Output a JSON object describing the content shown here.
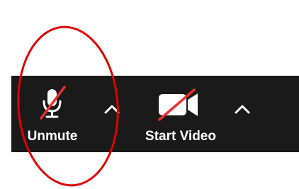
{
  "toolbar": {
    "background": "#1a1a1a",
    "audio": {
      "label": "Unmute",
      "icon": "microphone-muted-icon",
      "slash_color": "#e8302f",
      "menu_icon": "chevron-up-icon"
    },
    "video": {
      "label": "Start Video",
      "icon": "video-camera-off-icon",
      "slash_color": "#e8302f",
      "menu_icon": "chevron-up-icon"
    }
  },
  "annotation": {
    "shape": "ellipse",
    "color": "#e00000",
    "target": "unmute-button"
  }
}
